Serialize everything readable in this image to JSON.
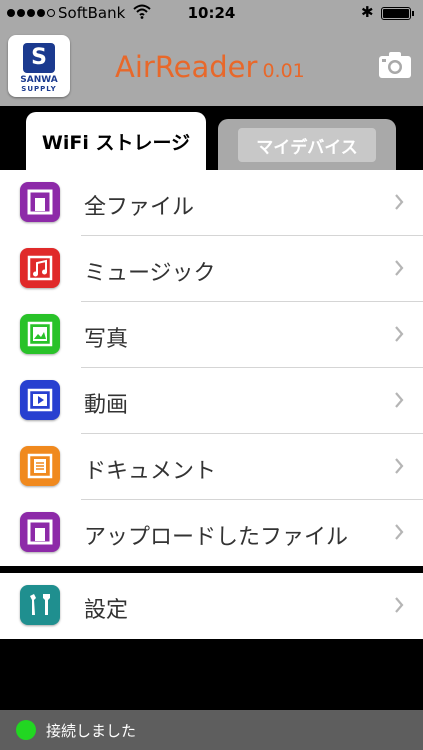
{
  "status_bar": {
    "carrier": "SoftBank",
    "time": "10:24",
    "bluetooth_glyph": "✱"
  },
  "header": {
    "logo": {
      "mark": "S",
      "line1": "SANWA",
      "line2": "SUPPLY"
    },
    "app_name": "AirReader",
    "version": "0.01",
    "accent_color": "#e8682a"
  },
  "tabs": {
    "active": "WiFi ストレージ",
    "inactive": "マイデバイス"
  },
  "list": [
    {
      "label": "全ファイル",
      "icon": "all-files-icon",
      "color": "#8d2aa8"
    },
    {
      "label": "ミュージック",
      "icon": "music-icon",
      "color": "#e02a2a"
    },
    {
      "label": "写真",
      "icon": "photo-icon",
      "color": "#29c229"
    },
    {
      "label": "動画",
      "icon": "video-icon",
      "color": "#2840d0"
    },
    {
      "label": "ドキュメント",
      "icon": "document-icon",
      "color": "#f0891e"
    },
    {
      "label": "アップロードしたファイル",
      "icon": "uploaded-files-icon",
      "color": "#8d2aa8"
    }
  ],
  "settings": {
    "label": "設定",
    "icon": "settings-tools-icon",
    "color": "#1f8f8f"
  },
  "connection": {
    "text": "接続しました",
    "color": "#22d622"
  }
}
